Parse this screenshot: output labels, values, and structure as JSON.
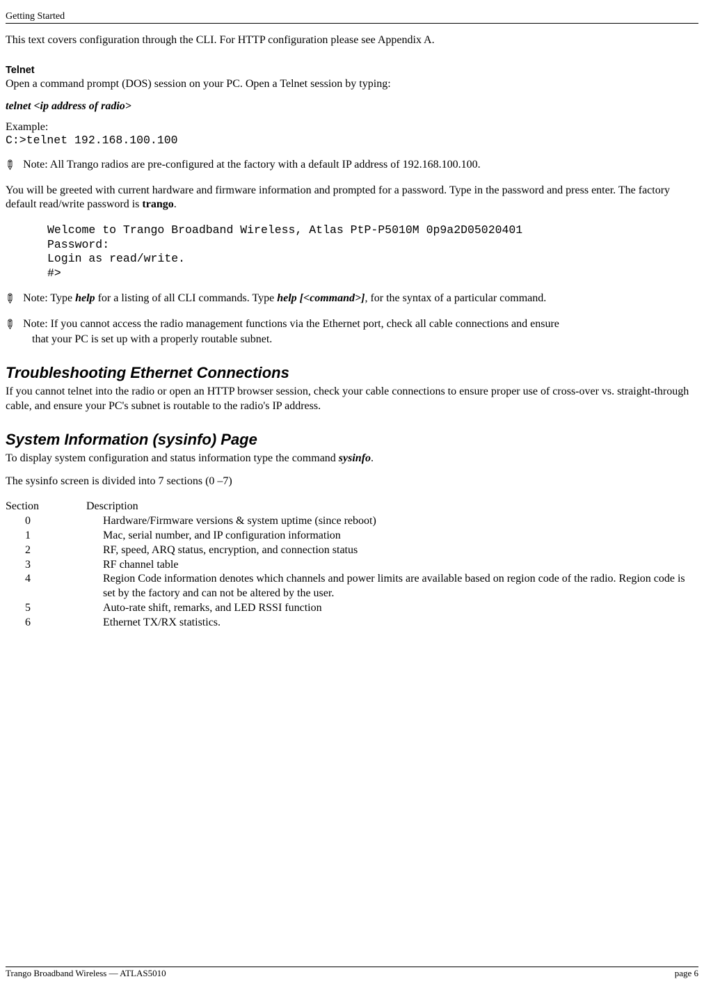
{
  "header": "Getting Started",
  "intro": "This text covers configuration through the CLI.  For HTTP configuration please see Appendix A.",
  "telnet": {
    "title": "Telnet",
    "line1": "Open a command prompt (DOS) session on your PC.  Open a Telnet session by typing:",
    "cmd_label": "telnet <ip address of radio>",
    "example_label": "Example:",
    "example_cmd": "C:>telnet 192.168.100.100"
  },
  "notes": {
    "n1": "Note:  All Trango radios are pre-configured at the factory with a default IP address of 192.168.100.100.",
    "n2_a": "You will be greeted with current hardware and firmware information and prompted for a password.  Type in the password and press enter.  The factory default read/write password is ",
    "n2_pw": "trango",
    "n2_b": ".",
    "welcome": "Welcome to Trango Broadband Wireless, Atlas PtP-P5010M 0p9a2D05020401\nPassword:\nLogin as read/write.\n#>",
    "n3_a": "Note:  Type ",
    "n3_help": "help",
    "n3_b": " for a listing of all CLI commands.  Type ",
    "n3_helpcmd": "help [<command>]",
    "n3_c": ", for the syntax of a particular command.",
    "n4": "Note:  If you cannot access the radio management functions via the Ethernet port, check all cable connections and ensure that your PC is set up with a properly routable subnet."
  },
  "troubleshoot": {
    "title": "Troubleshooting Ethernet Connections",
    "body": "If you cannot telnet into the radio or open an HTTP browser session, check your cable connections to ensure proper use of cross-over vs. straight-through cable, and ensure your PC's subnet is routable to the radio's IP address."
  },
  "sysinfo": {
    "title": "System Information (sysinfo) Page",
    "line1_a": "To display system configuration and status information type the command ",
    "line1_cmd": "sysinfo",
    "line1_b": ".",
    "line2": "The sysinfo screen is divided into 7 sections (0 –7)",
    "col_section": "Section",
    "col_desc": "Description",
    "rows": [
      {
        "s": "0",
        "d": "Hardware/Firmware versions & system uptime (since reboot)"
      },
      {
        "s": "1",
        "d": "Mac, serial number, and IP configuration information"
      },
      {
        "s": "2",
        "d": "RF, speed, ARQ status, encryption, and connection status"
      },
      {
        "s": "3",
        "d": "RF channel table"
      },
      {
        "s": "4",
        "d": "Region Code information denotes which channels and power limits are available based on region code of the radio.  Region code is set by the factory and can not be altered by the user."
      },
      {
        "s": "5",
        "d": "Auto-rate shift, remarks, and LED RSSI function"
      },
      {
        "s": "6",
        "d": "Ethernet TX/RX statistics."
      }
    ]
  },
  "footer": {
    "left": "Trango Broadband Wireless — ATLAS5010",
    "right": "page 6"
  }
}
